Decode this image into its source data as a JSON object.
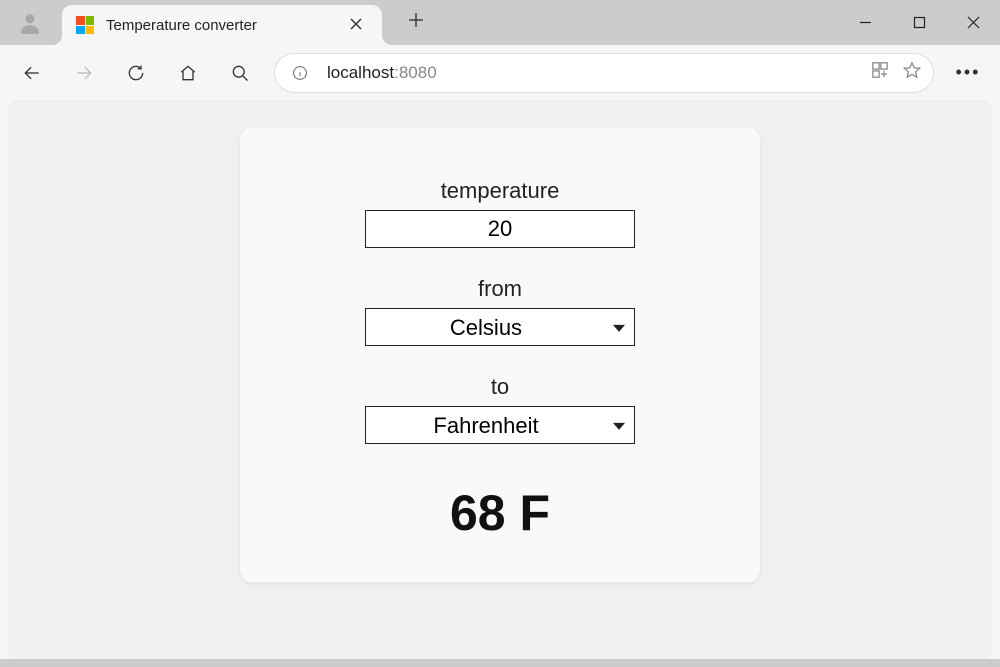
{
  "browser": {
    "tab_title": "Temperature converter",
    "url_host": "localhost",
    "url_port": ":8080"
  },
  "app": {
    "temperature_label": "temperature",
    "temperature_value": "20",
    "from_label": "from",
    "from_value": "Celsius",
    "to_label": "to",
    "to_value": "Fahrenheit",
    "result_text": "68 F"
  }
}
